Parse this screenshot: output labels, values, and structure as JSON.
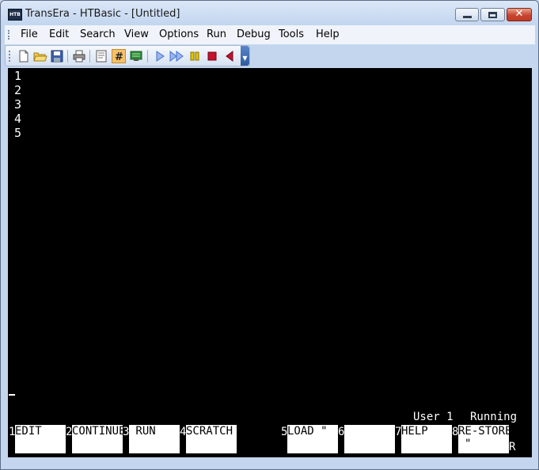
{
  "window": {
    "title": "TransEra - HTBasic - [Untitled]",
    "icon_text": "HTB"
  },
  "menu": [
    {
      "label": "File"
    },
    {
      "label": "Edit"
    },
    {
      "label": "Search"
    },
    {
      "label": "View"
    },
    {
      "label": "Options"
    },
    {
      "label": "Run"
    },
    {
      "label": "Debug"
    },
    {
      "label": "Tools"
    },
    {
      "label": "Help"
    }
  ],
  "toolbar": {
    "icons": [
      "new-file-icon",
      "open-folder-icon",
      "save-icon",
      "print-icon",
      "edit-notes-icon",
      "line-numbers-icon",
      "display-icon",
      "run-icon",
      "continue-icon",
      "pause-icon",
      "stop-icon",
      "step-back-icon"
    ],
    "active": "line-numbers-icon",
    "colors": {
      "run": "#3d6fd6",
      "pause": "#e2c400",
      "stop": "#c8102e",
      "back": "#c8102e",
      "active_bg": "#f6c16a"
    }
  },
  "editor": {
    "lines": [
      "1",
      "2",
      "3",
      "4",
      "5"
    ]
  },
  "status": {
    "user": "User 1",
    "state": "Running",
    "right_marker": "R"
  },
  "softkeys": [
    {
      "num": "1",
      "label": "EDIT",
      "label2": ""
    },
    {
      "num": "2",
      "label": "CONTINUE",
      "label2": ""
    },
    {
      "num": "3",
      "label": " RUN",
      "label2": ""
    },
    {
      "num": "4",
      "label": "SCRATCH",
      "label2": ""
    },
    {
      "num": "5",
      "label": "LOAD \"",
      "label2": ""
    },
    {
      "num": "6",
      "label": "",
      "label2": ""
    },
    {
      "num": "7",
      "label": "HELP",
      "label2": ""
    },
    {
      "num": "8",
      "label": "RE-STORE",
      "label2": "\""
    }
  ]
}
